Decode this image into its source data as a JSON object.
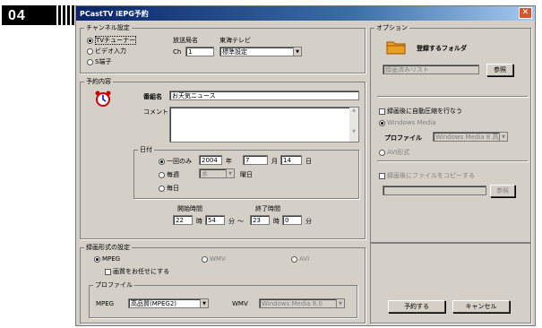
{
  "badge": "04",
  "window": {
    "title": "PCastTV iEPG予約",
    "close": "✕"
  },
  "channel": {
    "legend": "チャンネル設定",
    "source_options": [
      "TVチューナー",
      "ビデオ入力",
      "S端子"
    ],
    "station_label": "放送局名",
    "station_name": "東海テレビ",
    "ch_label": "Ch",
    "ch_value": "1",
    "preset_value": "標準設定"
  },
  "program": {
    "legend": "予約内容",
    "title_label": "番組名",
    "title_value": "お天気ニュース",
    "comment_label": "コメント",
    "date_legend": "日付",
    "once_label": "一回のみ",
    "year": "2004",
    "year_unit": "年",
    "month": "7",
    "month_unit": "月",
    "day": "14",
    "day_unit": "日",
    "weekly_label": "毎週",
    "weekday_value": "水",
    "weekday_unit": "曜日",
    "daily_label": "毎日",
    "start_label": "開始時間",
    "end_label": "終了時間",
    "start_hour": "22",
    "start_min": "54",
    "end_hour": "23",
    "end_min": "0",
    "hour_unit": "時",
    "min_unit": "分",
    "tilde": "〜"
  },
  "record": {
    "legend": "録画形式の設定",
    "formats": [
      "MPEG",
      "WMV",
      "AVI"
    ],
    "auto_quality": "画質をお任せにする",
    "profile_legend": "プロファイル",
    "mpeg_label": "MPEG",
    "mpeg_value": "高品質(MPEG2)",
    "wmv_label": "WMV",
    "wmv_value": "Windows Media 8.0"
  },
  "options": {
    "legend": "オプション",
    "folder_label": "登録するフォルダ",
    "folder_value": "録画済みリスト",
    "browse": "参照",
    "compress_label": "録画後に自動圧縮を行なう",
    "wm_label": "Windows Media",
    "profile_label": "プロファイル",
    "profile_value": "Windows Media 8 高品",
    "avi_label": "AVI形式",
    "copy_label": "録画後にファイルをコピーする",
    "browse2": "参照"
  },
  "buttons": {
    "reserve": "予約する",
    "cancel": "キャンセル"
  }
}
